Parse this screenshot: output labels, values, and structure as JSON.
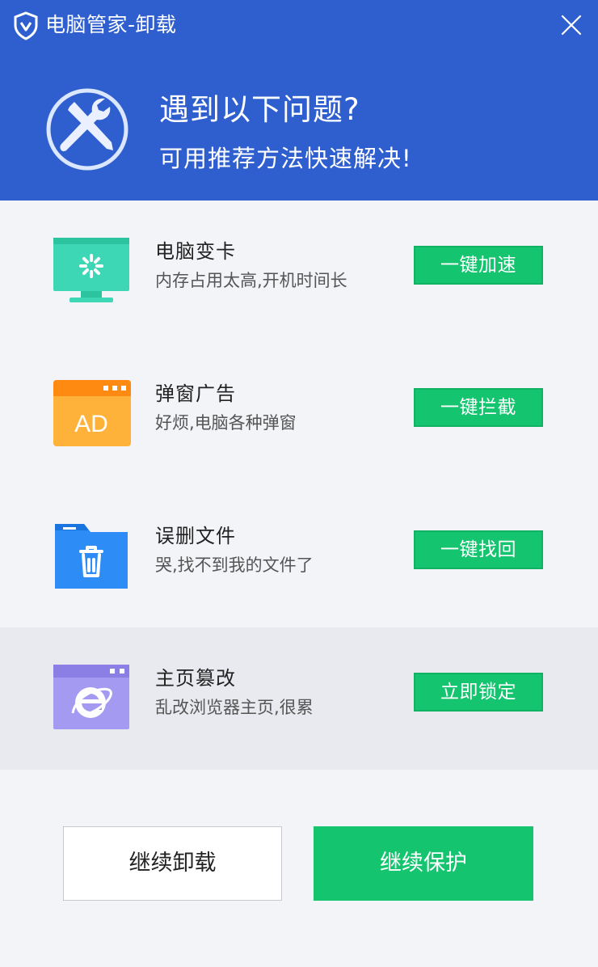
{
  "window": {
    "title": "电脑管家-卸载",
    "accent_color": "#2f5fcf",
    "logo_icon": "shield-icon",
    "close_icon": "close-icon"
  },
  "hero": {
    "icon": "wrench-screwdriver-icon",
    "title": "遇到以下问题?",
    "subtitle": "可用推荐方法快速解决!"
  },
  "problems": [
    {
      "icon": "monitor-loading-icon",
      "title": "电脑变卡",
      "desc": "内存占用太高,开机时间长",
      "button": "一键加速"
    },
    {
      "icon": "ad-window-icon",
      "icon_text": "AD",
      "title": "弹窗广告",
      "desc": "好烦,电脑各种弹窗",
      "button": "一键拦截"
    },
    {
      "icon": "folder-trash-icon",
      "title": "误删文件",
      "desc": "哭,找不到我的文件了",
      "button": "一键找回"
    },
    {
      "icon": "browser-ie-icon",
      "title": "主页篡改",
      "desc": "乱改浏览器主页,很累",
      "button": "立即锁定",
      "highlighted": true
    }
  ],
  "footer": {
    "uninstall_label": "继续卸载",
    "protect_label": "继续保护"
  },
  "button_color": "#14c46e"
}
